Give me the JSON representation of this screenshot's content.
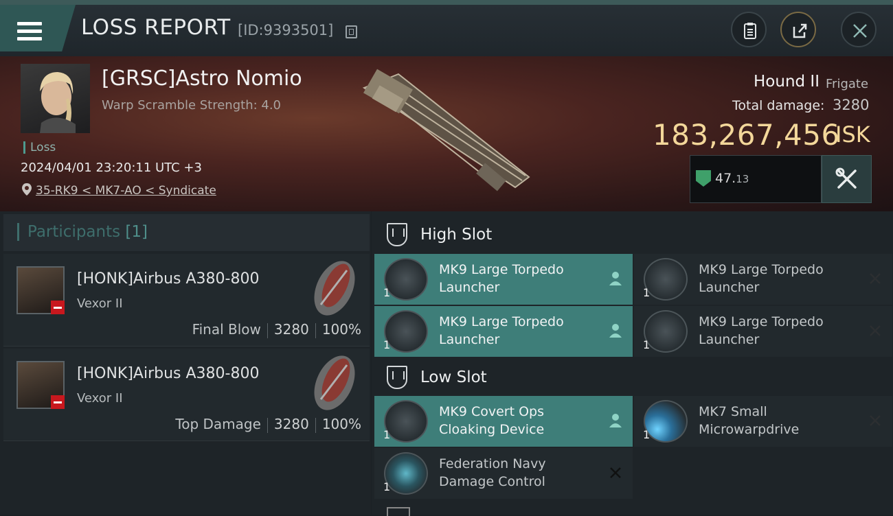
{
  "header": {
    "title": "LOSS REPORT",
    "id_label": "[ID:9393501]",
    "buttons": [
      "clipboard-icon",
      "share-icon",
      "close-icon"
    ]
  },
  "victim": {
    "name": "[GRSC]Astro Nomio",
    "scramble": "Warp Scramble Strength: 4.0",
    "status": "Loss",
    "timestamp": "2024/04/01 23:20:11 UTC +3",
    "location": "35-RK9 < MK7-AO < Syndicate",
    "ship_name": "Hound II",
    "ship_class": "Frigate",
    "damage_label": "Total damage:",
    "damage_value": "3280",
    "isk_value": "183,267,456",
    "isk_unit": "ISK",
    "rating_main": "47.",
    "rating_dec": "13"
  },
  "participants": {
    "title": "Participants",
    "count": "[1]",
    "rows": [
      {
        "name": "[HONK]Airbus A380-800",
        "ship": "Vexor II",
        "role": "Final Blow",
        "damage": "3280",
        "percent": "100%"
      },
      {
        "name": "[HONK]Airbus A380-800",
        "ship": "Vexor II",
        "role": "Top Damage",
        "damage": "3280",
        "percent": "100%"
      }
    ]
  },
  "slots": {
    "high": {
      "label": "High Slot",
      "modules": [
        {
          "line1": "MK9 Large Torpedo",
          "line2": "Launcher",
          "qty": "1",
          "state": "dropped"
        },
        {
          "line1": "MK9 Large Torpedo",
          "line2": "Launcher",
          "qty": "1",
          "state": "destroyed"
        },
        {
          "line1": "MK9 Large Torpedo",
          "line2": "Launcher",
          "qty": "1",
          "state": "dropped"
        },
        {
          "line1": "MK9 Large Torpedo",
          "line2": "Launcher",
          "qty": "1",
          "state": "destroyed"
        }
      ]
    },
    "low": {
      "label": "Low Slot",
      "modules": [
        {
          "line1": "MK9 Covert Ops",
          "line2": "Cloaking Device",
          "qty": "1",
          "state": "dropped"
        },
        {
          "line1": "MK7 Small",
          "line2": "Microwarpdrive",
          "qty": "1",
          "state": "destroyed"
        },
        {
          "line1": "Federation Navy",
          "line2": "Damage Control",
          "qty": "1",
          "state": "destroyed"
        }
      ]
    }
  },
  "colors": {
    "accent": "#3e7e79",
    "isk_gold": "#f3d79a",
    "loss_red": "#c8181e"
  }
}
